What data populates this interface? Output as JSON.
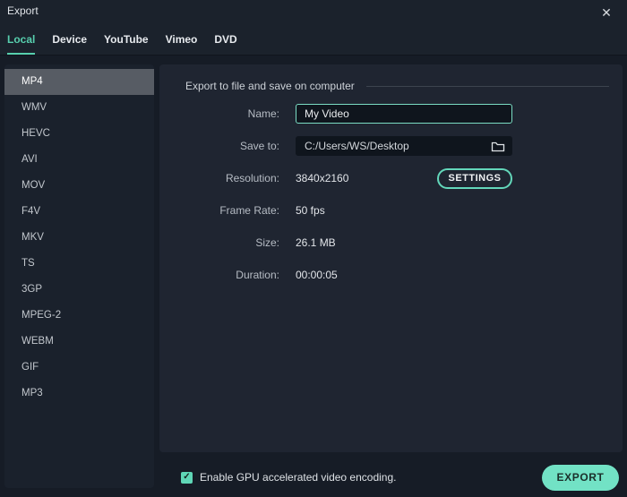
{
  "window": {
    "title": "Export",
    "close_icon": "✕"
  },
  "tabs": [
    {
      "label": "Local",
      "active": true
    },
    {
      "label": "Device",
      "active": false
    },
    {
      "label": "YouTube",
      "active": false
    },
    {
      "label": "Vimeo",
      "active": false
    },
    {
      "label": "DVD",
      "active": false
    }
  ],
  "sidebar": {
    "formats": [
      {
        "label": "MP4",
        "selected": true
      },
      {
        "label": "WMV",
        "selected": false
      },
      {
        "label": "HEVC",
        "selected": false
      },
      {
        "label": "AVI",
        "selected": false
      },
      {
        "label": "MOV",
        "selected": false
      },
      {
        "label": "F4V",
        "selected": false
      },
      {
        "label": "MKV",
        "selected": false
      },
      {
        "label": "TS",
        "selected": false
      },
      {
        "label": "3GP",
        "selected": false
      },
      {
        "label": "MPEG-2",
        "selected": false
      },
      {
        "label": "WEBM",
        "selected": false
      },
      {
        "label": "GIF",
        "selected": false
      },
      {
        "label": "MP3",
        "selected": false
      }
    ]
  },
  "main": {
    "section_title": "Export to file and save on computer",
    "fields": {
      "name": {
        "label": "Name:",
        "value": "My Video"
      },
      "save_to": {
        "label": "Save to:",
        "value": "C:/Users/WS/Desktop",
        "icon": "folder-icon"
      },
      "resolution": {
        "label": "Resolution:",
        "value": "3840x2160",
        "button_label": "SETTINGS"
      },
      "frame_rate": {
        "label": "Frame Rate:",
        "value": "50 fps"
      },
      "size": {
        "label": "Size:",
        "value": "26.1 MB"
      },
      "duration": {
        "label": "Duration:",
        "value": "00:00:05"
      }
    }
  },
  "footer": {
    "gpu_checkbox": {
      "checked": true,
      "check_icon": "✓",
      "label": "Enable GPU accelerated video encoding."
    },
    "export_button": "EXPORT"
  },
  "colors": {
    "accent": "#57cfae",
    "export_button_bg": "#72e2c5",
    "selected_format_bg": "#575c64"
  }
}
